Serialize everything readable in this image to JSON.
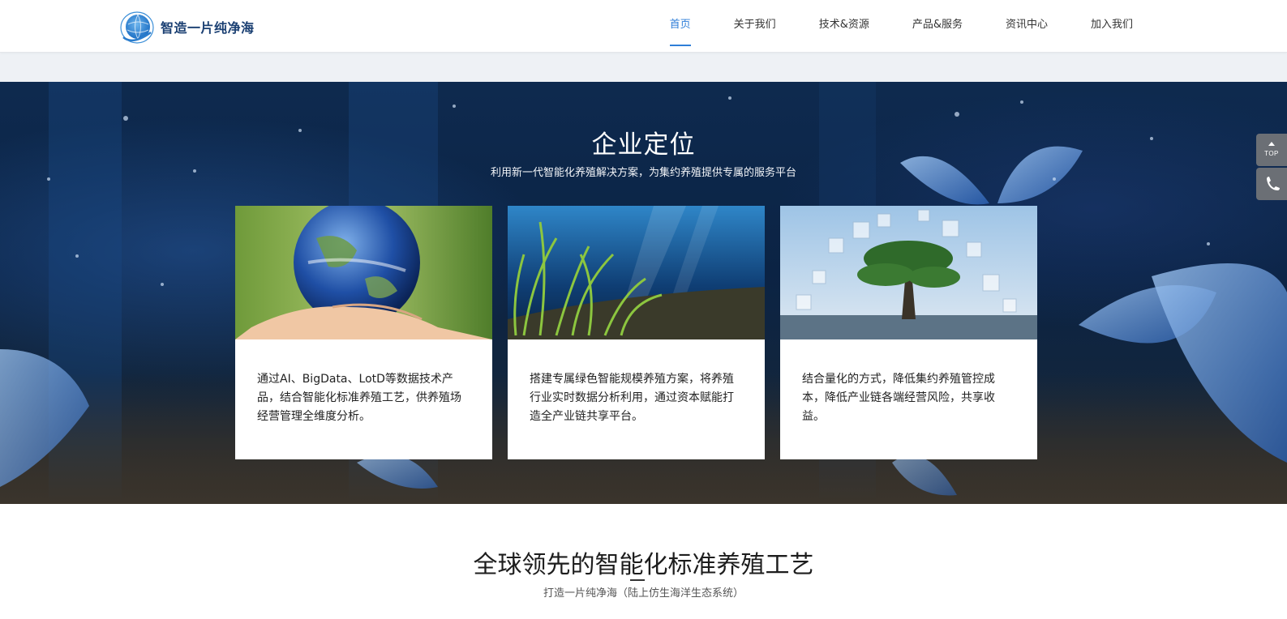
{
  "header": {
    "logo_text": "智造一片纯净海",
    "nav": [
      {
        "label": "首页",
        "active": true
      },
      {
        "label": "关于我们"
      },
      {
        "label": "技术&资源"
      },
      {
        "label": "产品&服务"
      },
      {
        "label": "资讯中心"
      },
      {
        "label": "加入我们"
      }
    ]
  },
  "hero": {
    "title": "企业定位",
    "subtitle": "利用新一代智能化养殖解决方案，为集约养殖提供专属的服务平台",
    "cards": [
      {
        "image": "earth-in-hands",
        "text": "通过AI、BigData、LotD等数据技术产品，结合智能化标准养殖工艺，供养殖场经营管理全维度分析。"
      },
      {
        "image": "underwater-seagrass",
        "text": "搭建专属绿色智能规模养殖方案，将养殖行业实时数据分析利用，通过资本赋能打造全产业链共享平台。"
      },
      {
        "image": "digital-tree",
        "text": "结合量化的方式，降低集约养殖管控成本，降低产业链各端经营风险，共享收益。"
      }
    ]
  },
  "side_tools": {
    "top_label": "TOP",
    "top_icon": "arrow-up-icon",
    "phone_icon": "phone-icon"
  },
  "section2": {
    "title": "全球领先的智能化标准养殖工艺",
    "subtitle": "打造一片纯净海（陆上仿生海洋生态系统）"
  },
  "colors": {
    "accent": "#2e7ed8",
    "logo_text": "#1a3f72",
    "side_button": "#6b6f75"
  }
}
